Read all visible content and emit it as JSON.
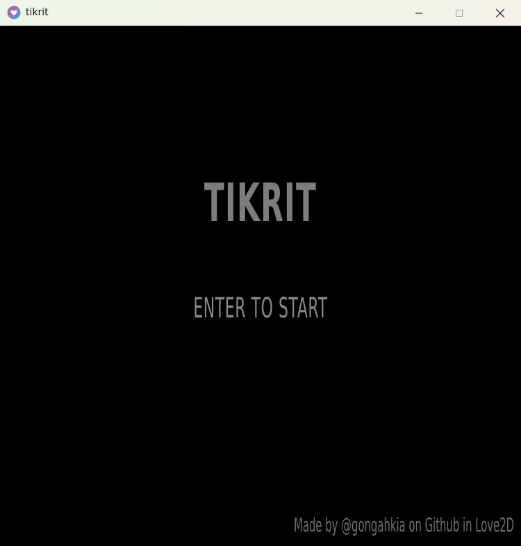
{
  "window": {
    "title": "tikrit",
    "icon": "love2d-heart-icon"
  },
  "controls": {
    "minimize": "minimize-icon",
    "maximize": "maximize-icon",
    "close": "close-icon"
  },
  "game": {
    "title": "TIKRIT",
    "prompt": "ENTER TO START",
    "credits": "Made by @gongahkia on Github in Love2D",
    "text_color": "#7d7d7d",
    "background_color": "#000000"
  }
}
